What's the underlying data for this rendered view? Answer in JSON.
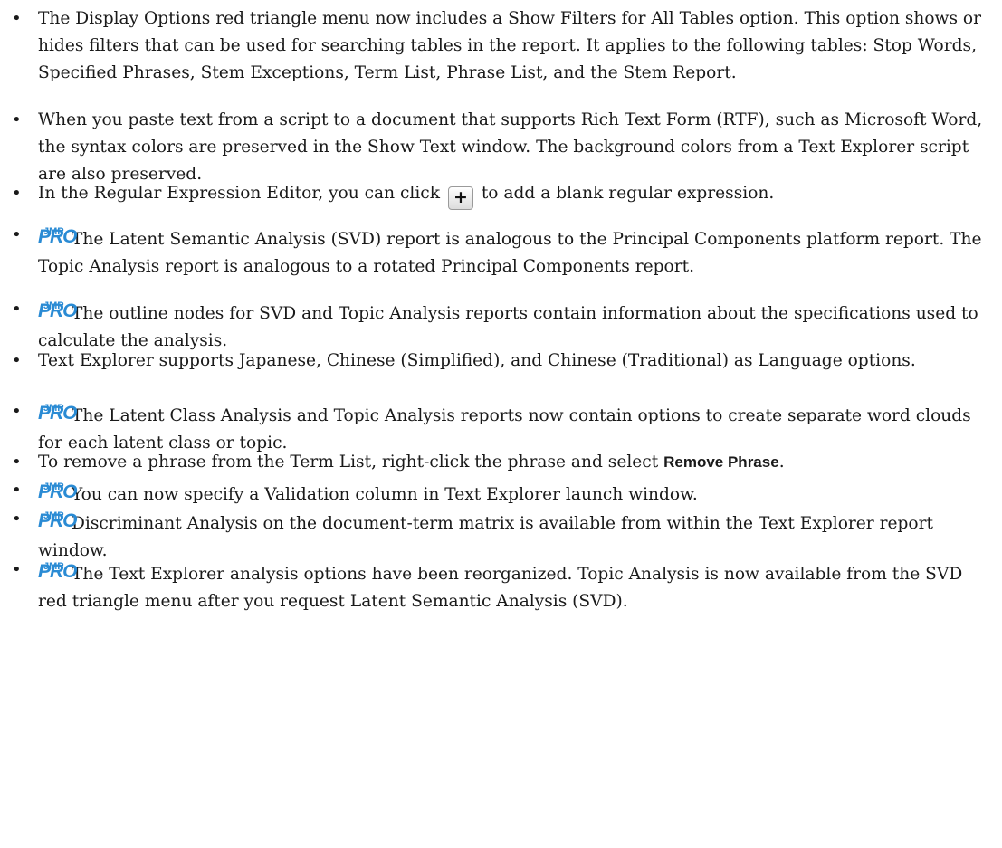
{
  "bullet": "•",
  "badge": {
    "jmp": "JMP",
    "pro": "PRO",
    "color": "#2a8bd4"
  },
  "items": [
    {
      "text": "The Display Options red triangle menu now includes a Show Filters for All Tables option. This option shows or hides filters that can be used for searching tables in the report. It applies to the following tables: Stop Words, Specified Phrases, Stem Exceptions, Term List, Phrase List, and the Stem Report."
    },
    {
      "text": "When you paste text from a script to a document that supports Rich Text Form (RTF), such as Microsoft Word, the syntax colors are preserved in the Show Text window. The background colors from a Text Explorer script are also preserved."
    },
    {
      "before": "In the Regular Expression Editor, you can click",
      "icon": "+",
      "after": "to add a blank regular expression."
    },
    {
      "text": "The Latent Semantic Analysis (SVD) report is analogous to the Principal Components platform report. The Topic Analysis report is analogous to a rotated Principal Components report."
    },
    {
      "text": "The outline nodes for SVD and Topic Analysis reports contain information about the specifications used to calculate the analysis."
    },
    {
      "text": "Text Explorer supports Japanese, Chinese (Simplified), and Chinese (Traditional) as Language options."
    },
    {
      "text": "The Latent Class Analysis and Topic Analysis reports now contain options to create separate word clouds for each latent class or topic."
    },
    {
      "before": "To remove a phrase from the Term List, right-click the phrase and select",
      "term": "Remove Phrase",
      "after": "."
    },
    {
      "text": "You can now specify a Validation column in Text Explorer launch window."
    },
    {
      "text": "Discriminant Analysis on the document-term matrix is available from within the Text Explorer report window."
    },
    {
      "text": "The Text Explorer analysis options have been reorganized. Topic Analysis is now available from the SVD red triangle menu after you request Latent Semantic Analysis (SVD)."
    }
  ]
}
